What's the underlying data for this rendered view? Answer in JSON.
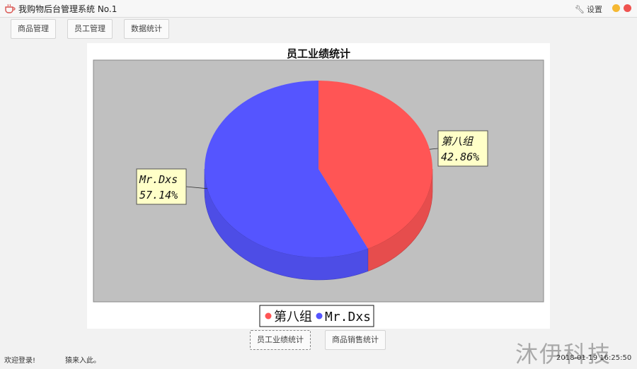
{
  "window": {
    "title": "我购物后台管理系统 No.1",
    "settings_label": "设置"
  },
  "nav": {
    "products": "商品管理",
    "employees": "员工管理",
    "stats": "数据统计"
  },
  "chart_data": {
    "type": "pie",
    "title": "员工业绩统计",
    "labels": [
      "第八组",
      "Mr.Dxs"
    ],
    "values": [
      42.86,
      57.14
    ],
    "percent_labels": [
      "42.86%",
      "57.14%"
    ],
    "colors": [
      "#ff5555",
      "#5555ff"
    ],
    "legend": [
      "第八组",
      "Mr.Dxs"
    ],
    "legend_position": "bottom",
    "plot_background": "#c0c0c0",
    "style": "3d"
  },
  "bottom_tabs": {
    "employee_stats": "员工业绩统计",
    "product_stats": "商品销售统计"
  },
  "status": {
    "welcome": "欢迎登录!",
    "message": "猿来入此。",
    "datetime": "2018-01-19 16:25:50"
  },
  "watermark": "沐伊科技"
}
